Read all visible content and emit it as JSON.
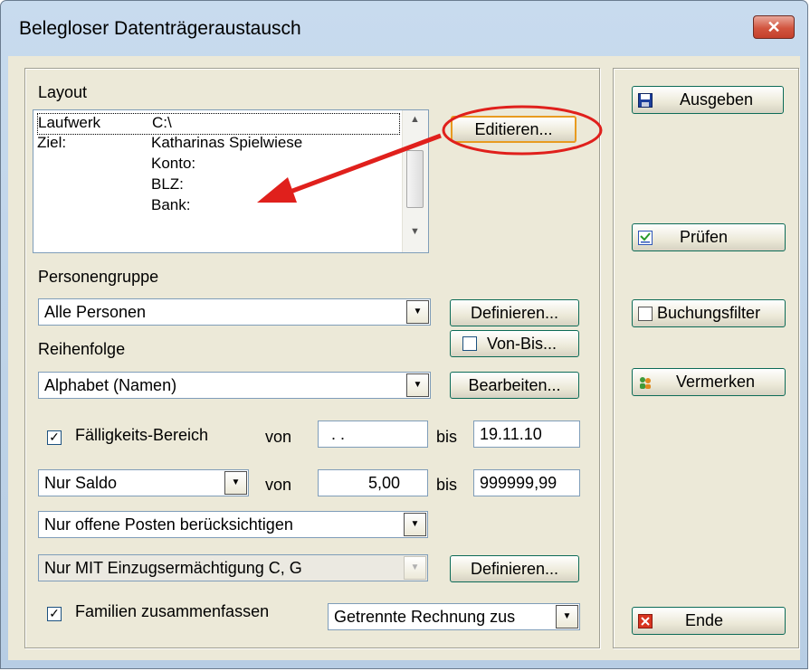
{
  "window": {
    "title": "Belegloser Datenträgeraustausch",
    "close_glyph": "✕"
  },
  "layout_group": {
    "label": "Layout",
    "list": [
      {
        "key": "Laufwerk",
        "value": "C:\\"
      },
      {
        "key": "Ziel:",
        "value": "Katharinas Spielwiese"
      },
      {
        "key": "",
        "value": "Konto:"
      },
      {
        "key": "",
        "value": "BLZ:"
      },
      {
        "key": "",
        "value": "Bank:"
      }
    ],
    "edit_button": "Editieren..."
  },
  "personengruppe": {
    "label": "Personengruppe",
    "value": "Alle Personen",
    "button": "Definieren..."
  },
  "von_bis": {
    "label": "Von-Bis..."
  },
  "reihenfolge": {
    "label": "Reihenfolge",
    "value": "Alphabet (Namen)",
    "button": "Bearbeiten..."
  },
  "faelligkeit": {
    "label": "Fälligkeits-Bereich",
    "checked_glyph": "✓",
    "von_label": "von",
    "von_value": ". .",
    "bis_label": "bis",
    "bis_value": "19.11.10"
  },
  "saldo": {
    "select": "Nur Saldo",
    "von_label": "von",
    "von_value": "5,00",
    "bis_label": "bis",
    "bis_value": "999999,99"
  },
  "posten": {
    "select": "Nur offene Posten berücksichtigen"
  },
  "einzug": {
    "select": "Nur MIT Einzugsermächtigung C, G",
    "button": "Definieren..."
  },
  "familien": {
    "label": "Familien zusammenfassen",
    "checked_glyph": "✓",
    "select": "Getrennte Rechnung zus"
  },
  "side_buttons": {
    "ausgeben": "Ausgeben",
    "pruefen": "Prüfen",
    "buchungsfilter": "Buchungsfilter",
    "vermerken": "Vermerken",
    "ende": "Ende"
  },
  "colors": {
    "annotation": "#e0201c",
    "button_border": "#0c6b57",
    "focus": "#e89b20"
  }
}
